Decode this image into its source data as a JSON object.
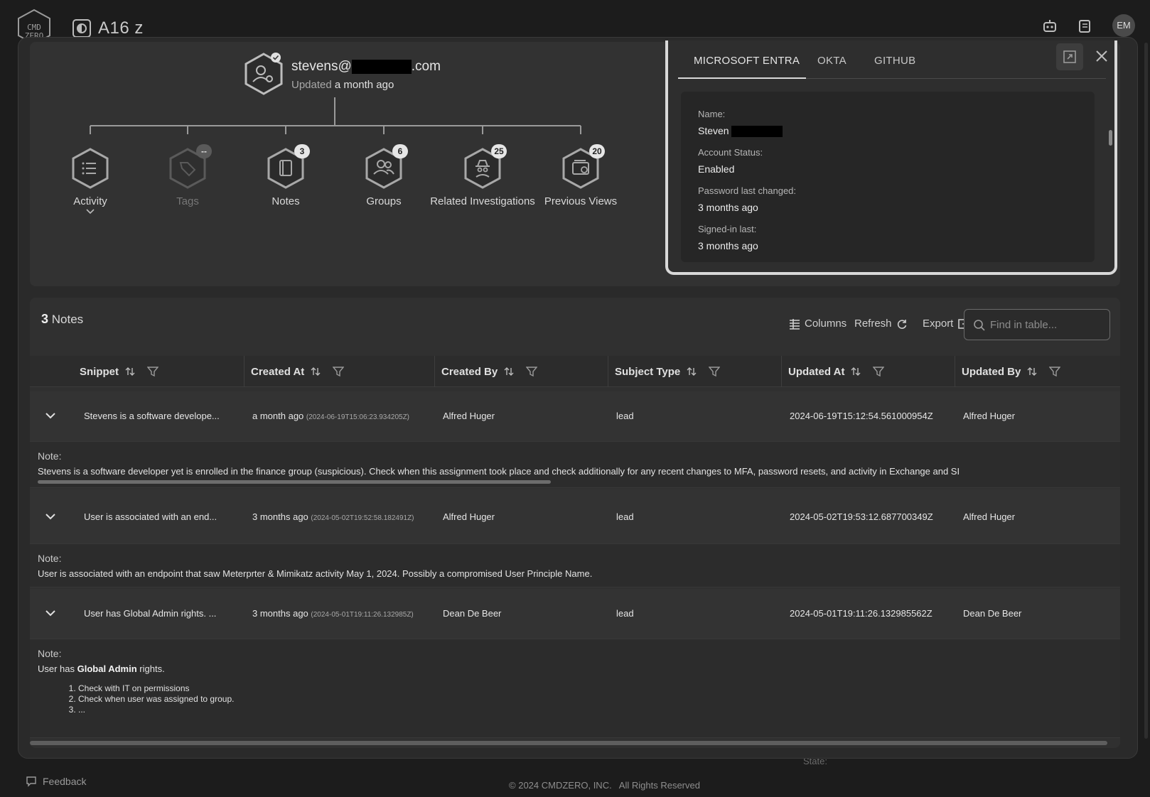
{
  "app": {
    "org_name": "A16 z",
    "avatar_initials": "EM"
  },
  "user": {
    "email_prefix": "stevens@",
    "email_suffix": ".com",
    "updated_prefix": "Updated",
    "updated_value": "a month ago"
  },
  "nodes": [
    {
      "label": "Activity",
      "badge": "",
      "icon": "list-icon"
    },
    {
      "label": "Tags",
      "badge": "--",
      "icon": "tag-icon"
    },
    {
      "label": "Notes",
      "badge": "3",
      "icon": "notebook-icon"
    },
    {
      "label": "Groups",
      "badge": "6",
      "icon": "users-icon"
    },
    {
      "label": "Related Investigations",
      "badge": "25",
      "icon": "spy-icon"
    },
    {
      "label": "Previous Views",
      "badge": "20",
      "icon": "wallet-icon"
    }
  ],
  "entra": {
    "tabs": [
      "MICROSOFT ENTRA",
      "OKTA",
      "GITHUB"
    ],
    "active_tab": "MICROSOFT ENTRA",
    "fields": [
      {
        "label": "Name:",
        "value": "Steven"
      },
      {
        "label": "Account Status:",
        "value": "Enabled"
      },
      {
        "label": "Password last changed:",
        "value": "3 months ago"
      },
      {
        "label": "Signed-in last:",
        "value": "3 months ago"
      }
    ]
  },
  "notes": {
    "count": "3",
    "title": "Notes",
    "toolbar": {
      "columns": "Columns",
      "refresh": "Refresh",
      "export": "Export"
    },
    "search_placeholder": "Find in table...",
    "columns": [
      "Snippet",
      "Created At",
      "Created By",
      "Subject Type",
      "Updated At",
      "Updated By"
    ],
    "note_label": "Note:",
    "rows": [
      {
        "snippet": "Stevens is a software develope...",
        "created_rel": "a month ago",
        "created_abs": "(2024-06-19T15:06:23.934205Z)",
        "created_by": "Alfred Huger",
        "subject_type": "lead",
        "updated_at": "2024-06-19T15:12:54.561000954Z",
        "updated_by": "Alfred Huger",
        "note": "Stevens is a software developer yet is enrolled in the finance group (suspicious). Check when this assignment took place and check additionally for any recent changes to MFA, password resets, and activity in Exchange and SI"
      },
      {
        "snippet": "User is associated with an end...",
        "created_rel": "3 months ago",
        "created_abs": "(2024-05-02T19:52:58.182491Z)",
        "created_by": "Alfred Huger",
        "subject_type": "lead",
        "updated_at": "2024-05-02T19:53:12.687700349Z",
        "updated_by": "Alfred Huger",
        "note": "User is associated with an endpoint that saw Meterprter & Mimikatz activity May 1, 2024. Possibly a compromised User Principle Name."
      },
      {
        "snippet": "User has Global Admin rights. ...",
        "created_rel": "3 months ago",
        "created_abs": "(2024-05-01T19:11:26.132985Z)",
        "created_by": "Dean De Beer",
        "subject_type": "lead",
        "updated_at": "2024-05-01T19:11:26.132985562Z",
        "updated_by": "Dean De Beer",
        "note_prefix": "User has ",
        "note_bold": "Global Admin",
        "note_suffix": " rights.",
        "note_list": [
          "Check with IT on permissions",
          "Check when user was assigned to group.",
          "..."
        ]
      }
    ]
  },
  "footer": {
    "feedback": "Feedback",
    "copyright": "2024 CMDZERO, INC.   All Rights Reserved",
    "background_label": "State:"
  },
  "colors": {
    "background": "#1c1c1c",
    "panel": "#323232",
    "accent": "#d8d8d8"
  }
}
